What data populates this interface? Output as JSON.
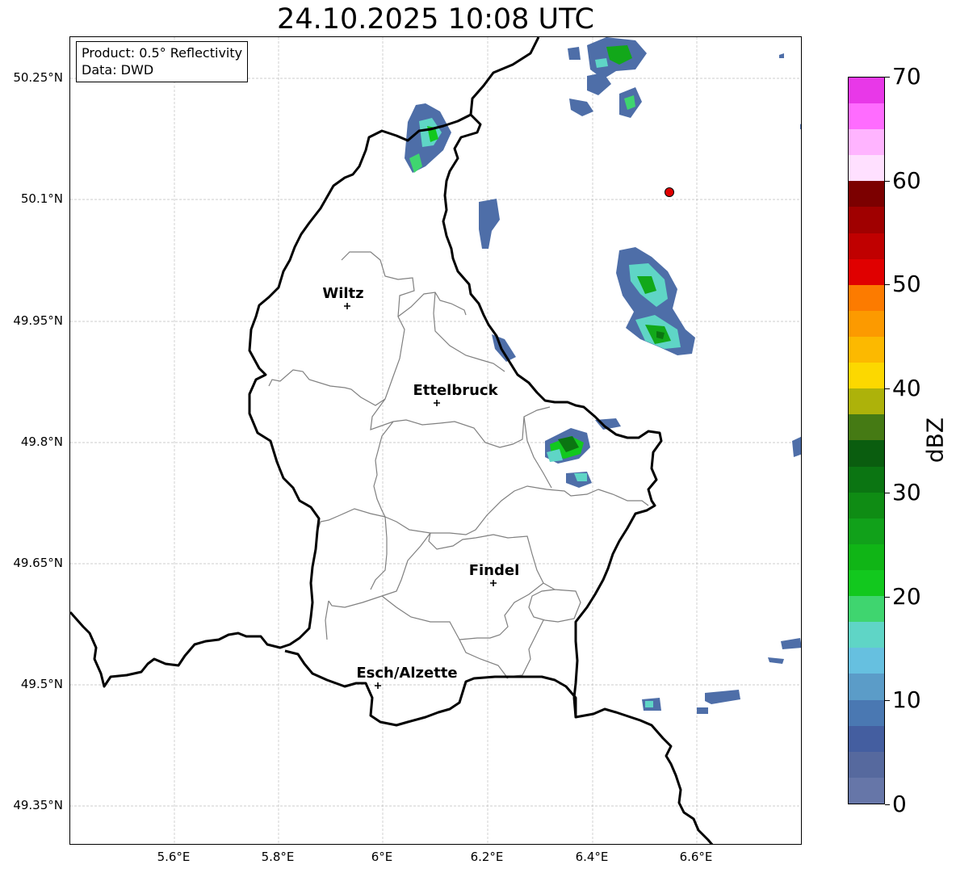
{
  "title": "24.10.2025 10:08 UTC",
  "info_box": {
    "product": "Product: 0.5° Reflectivity",
    "data_source": "Data: DWD"
  },
  "map": {
    "lat_ticks": [
      "50.25°N",
      "50.1°N",
      "49.95°N",
      "49.8°N",
      "49.65°N",
      "49.5°N",
      "49.35°N"
    ],
    "lon_ticks": [
      "5.6°E",
      "5.8°E",
      "6°E",
      "6.2°E",
      "6.4°E",
      "6.6°E"
    ],
    "cities": [
      {
        "name": "Wiltz",
        "lat": 49.966,
        "lon": 5.932
      },
      {
        "name": "Ettelbruck",
        "lat": 49.847,
        "lon": 6.104
      },
      {
        "name": "Findel",
        "lat": 49.626,
        "lon": 6.211
      },
      {
        "name": "Esch/Alzette",
        "lat": 49.5,
        "lon": 5.99
      }
    ],
    "radar_site": {
      "lat": 50.11,
      "lon": 6.548,
      "color": "#e00000"
    }
  },
  "colorbar": {
    "unit": "dBZ",
    "tick_labels": [
      "0",
      "10",
      "20",
      "30",
      "40",
      "50",
      "60",
      "70"
    ],
    "min": 0,
    "max": 70,
    "step": 2.5,
    "colors": [
      "#6676a8",
      "#56699e",
      "#445ea0",
      "#4a78b2",
      "#5b9cc8",
      "#66c0e0",
      "#5fd5c6",
      "#3fd56f",
      "#12c81e",
      "#10b516",
      "#11a11a",
      "#0f8c14",
      "#0b7512",
      "#0a5d0f",
      "#457a14",
      "#adb20a",
      "#fcd800",
      "#fcb900",
      "#fc9a00",
      "#fc7b00",
      "#e00000",
      "#c00000",
      "#a00000",
      "#7c0000",
      "#ffe0ff",
      "#ffb4ff",
      "#ff6cff",
      "#e838e8"
    ]
  }
}
